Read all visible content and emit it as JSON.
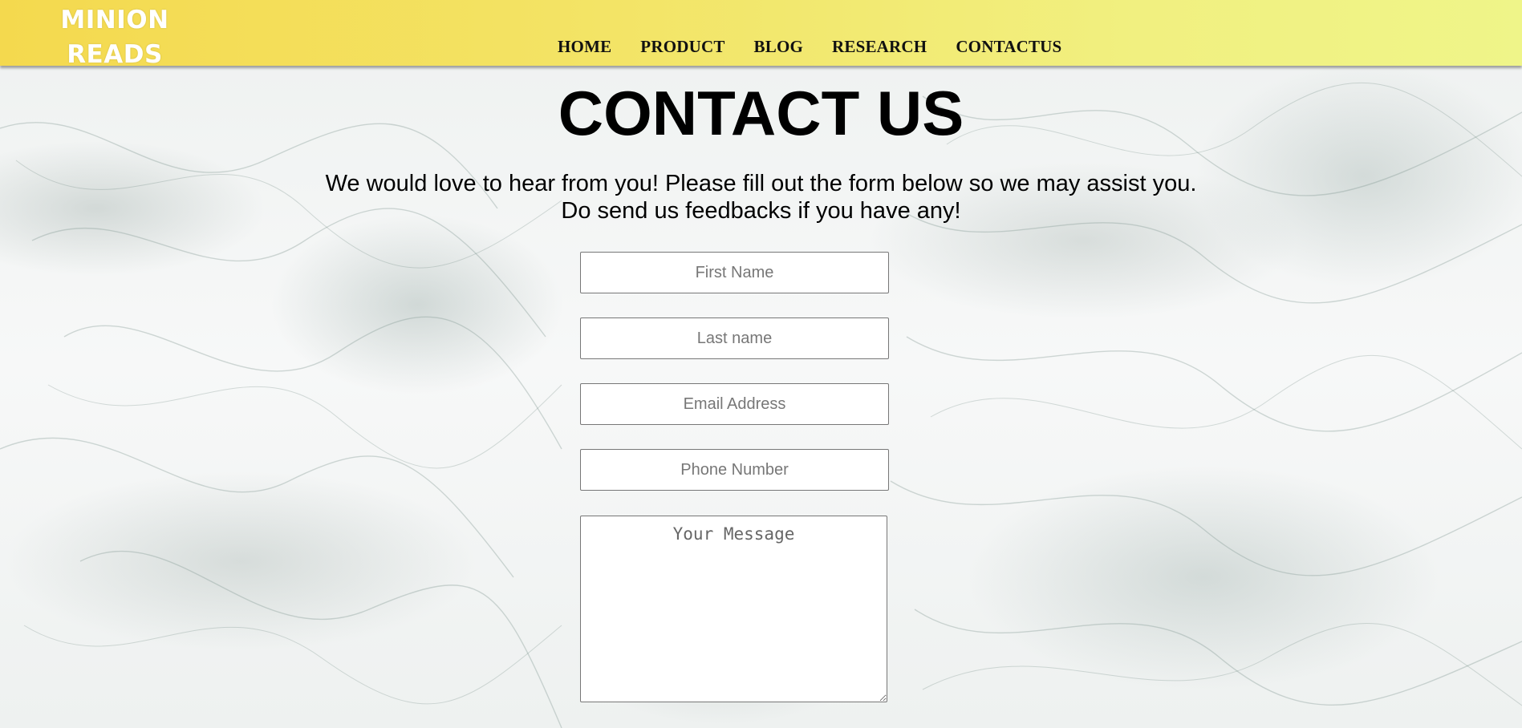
{
  "header": {
    "logo_line1": "MINION",
    "logo_line2": "READS",
    "nav": [
      "HOME",
      "PRODUCT",
      "BLOG",
      "RESEARCH",
      "CONTACTUS"
    ],
    "colors": {
      "gradient_start": "#f4d94e",
      "gradient_end": "#eff589",
      "logo_text": "#ffffff"
    }
  },
  "main": {
    "title": "CONTACT US",
    "subtitle_line1": "We would love to hear from you! Please fill out the form below so we may assist you.",
    "subtitle_line2": "Do send us feedbacks if you have any!"
  },
  "form": {
    "first_name_placeholder": "First Name",
    "last_name_placeholder": "Last name",
    "email_placeholder": "Email Address",
    "phone_placeholder": "Phone Number",
    "message_placeholder": "Your Message"
  }
}
